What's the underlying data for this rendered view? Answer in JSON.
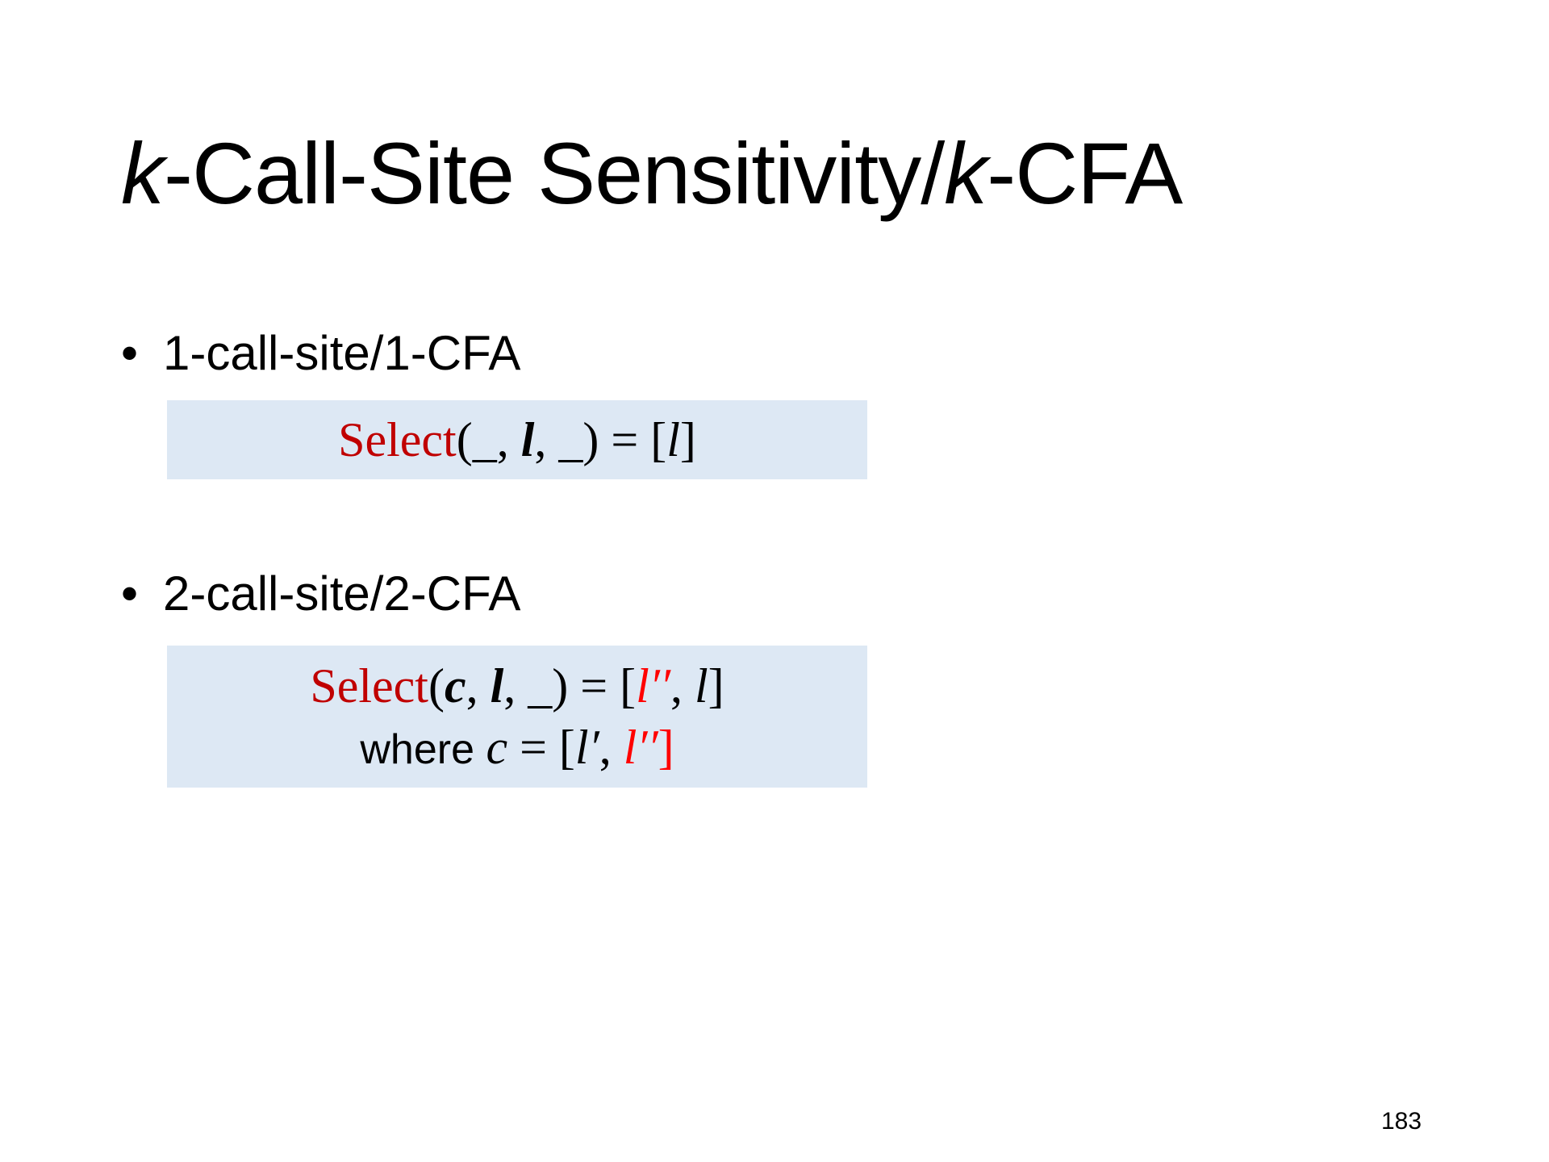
{
  "title": {
    "k1": "k",
    "part1": "-Call-Site Sensitivity/",
    "k2": "k",
    "part2": "-CFA"
  },
  "bullets": [
    {
      "marker": "•",
      "text": "1-call-site/1-CFA"
    },
    {
      "marker": "•",
      "text": "2-call-site/2-CFA"
    }
  ],
  "formula1": {
    "fn": "Select",
    "open": "(_, ",
    "arg": "l",
    "rest": ", _) = [",
    "result": "l",
    "close": "]"
  },
  "formula2": {
    "fn": "Select",
    "open": "(",
    "arg_c": "c",
    "sep1": ", ",
    "arg_l": "l",
    "rest": ", _) = [",
    "res1": "l′′",
    "sep2": ", ",
    "res2": "l",
    "close": "]",
    "where": "where ",
    "c": "c",
    "eq": " = [",
    "lp": "l′",
    "sep3": ", ",
    "lpp": "l′′",
    "close2": "]"
  },
  "page_number": "183",
  "colors": {
    "highlight_box": "#dde8f4",
    "select_red": "#c00000",
    "var_red": "#ff0000"
  }
}
